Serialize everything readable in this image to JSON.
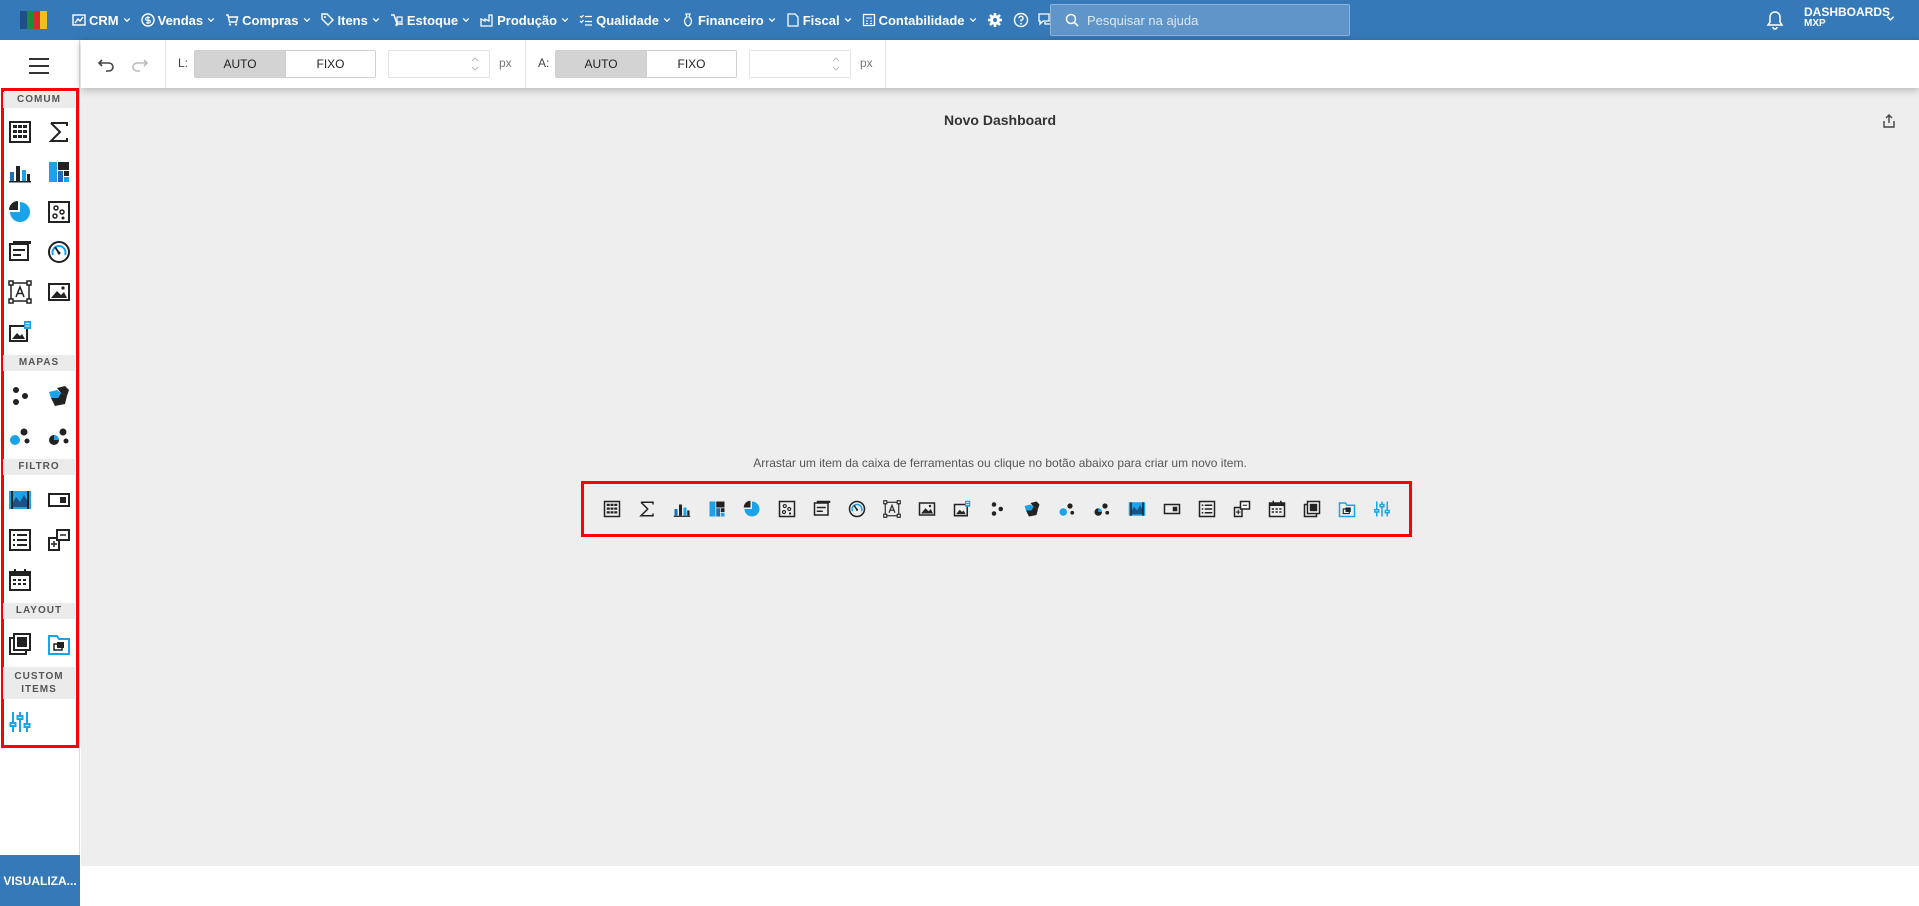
{
  "nav": {
    "menus": [
      {
        "label": "CRM",
        "icon": "chart-icon"
      },
      {
        "label": "Vendas",
        "icon": "dollar-icon"
      },
      {
        "label": "Compras",
        "icon": "cart-icon"
      },
      {
        "label": "Itens",
        "icon": "tags-icon"
      },
      {
        "label": "Estoque",
        "icon": "dolly-icon"
      },
      {
        "label": "Produção",
        "icon": "factory-icon"
      },
      {
        "label": "Qualidade",
        "icon": "list-check-icon"
      },
      {
        "label": "Financeiro",
        "icon": "moneybag-icon"
      },
      {
        "label": "Fiscal",
        "icon": "document-icon"
      },
      {
        "label": "Contabilidade",
        "icon": "calculator-icon"
      }
    ],
    "search_placeholder": "Pesquisar na ajuda",
    "user_line1": "DASHBOARDS",
    "user_line2": "MXP"
  },
  "toolbar": {
    "width_label": "L:",
    "height_label": "A:",
    "auto_label": "AUTO",
    "fixed_label": "FIXO",
    "unit": "px"
  },
  "toolbox": {
    "sections": {
      "comum": "COMUM",
      "mapas": "MAPAS",
      "filtro": "FILTRO",
      "layout": "LAYOUT",
      "custom_line1": "CUSTOM",
      "custom_line2": "ITEMS"
    },
    "visualize_label": "VISUALIZA..."
  },
  "dashboard": {
    "title": "Novo Dashboard",
    "hint": "Arrastar um item da caixa de ferramentas ou clique no botão abaixo para criar um novo item."
  },
  "colors": {
    "brand": "#3579b8",
    "accent": "#1aa3e8",
    "highlight": "#ff0000"
  }
}
